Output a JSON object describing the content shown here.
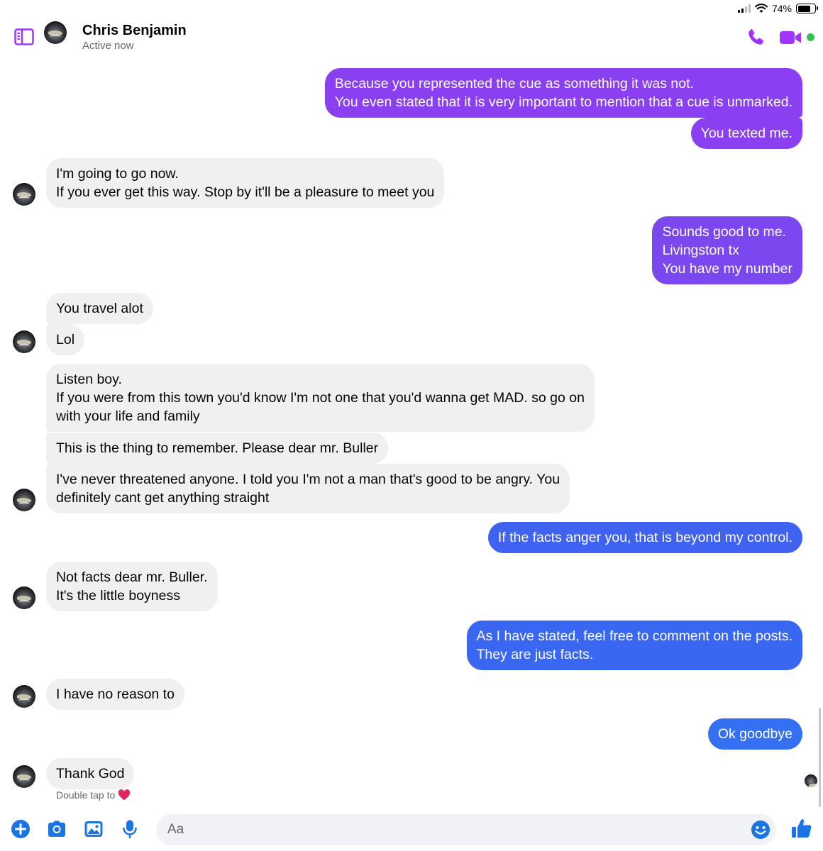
{
  "status_bar": {
    "battery_text": "74%",
    "battery_level": 0.74
  },
  "header": {
    "name": "Chris Benjamin",
    "status": "Active now",
    "icons": {
      "sidebar": "sidebar-toggle-icon",
      "call": "phone-icon",
      "video": "video-camera-icon"
    },
    "accent_color": "#a033ff"
  },
  "messages": [
    {
      "side": "out",
      "text": "Because you represented the cue as something it was not.\nYou even stated that it is very important to mention that a cue is unmarked.",
      "color": "#8a3ff0"
    },
    {
      "side": "out",
      "text": "You texted me.",
      "color": "#8a3ff0"
    },
    {
      "side": "in",
      "text": "I'm going to go now.\nIf you ever get this way. Stop by it'll be a pleasure to meet you"
    },
    {
      "side": "out",
      "text": "Sounds good to me.\nLivingston tx\nYou have my number",
      "color": "#7a48ee"
    },
    {
      "side": "in",
      "text": "You travel alot"
    },
    {
      "side": "in",
      "text": "Lol"
    },
    {
      "side": "in",
      "text": "Listen boy.\nIf you were from this town you'd know I'm not one that you'd wanna get MAD. so go on\nwith your life and family"
    },
    {
      "side": "in",
      "text": "This is the thing to remember. Please dear mr. Buller"
    },
    {
      "side": "in",
      "text": "I've never threatened anyone. I told you I'm not a man that's good to be angry. You\ndefinitely cant get anything straight"
    },
    {
      "side": "out",
      "text": "If the facts anger you, that is beyond my control.",
      "color": "#3f63f0"
    },
    {
      "side": "in",
      "text": "Not facts dear mr. Buller.\nIt's the little boyness"
    },
    {
      "side": "out",
      "text": "As I have stated, feel free to comment on the posts.\nThey are just facts.",
      "color": "#3a67f2"
    },
    {
      "side": "in",
      "text": "I have no reason to"
    },
    {
      "side": "out",
      "text": "Ok goodbye",
      "color": "#3570f2"
    },
    {
      "side": "in",
      "text": "Thank God"
    }
  ],
  "reaction_hint": {
    "text": "Double tap to",
    "emoji": "heart-icon"
  },
  "composer": {
    "placeholder": "Aa",
    "icons": [
      "plus-icon",
      "camera-icon",
      "image-icon",
      "microphone-icon",
      "emoji-icon",
      "thumbs-up-icon"
    ],
    "icon_color": "#1b74e4"
  }
}
